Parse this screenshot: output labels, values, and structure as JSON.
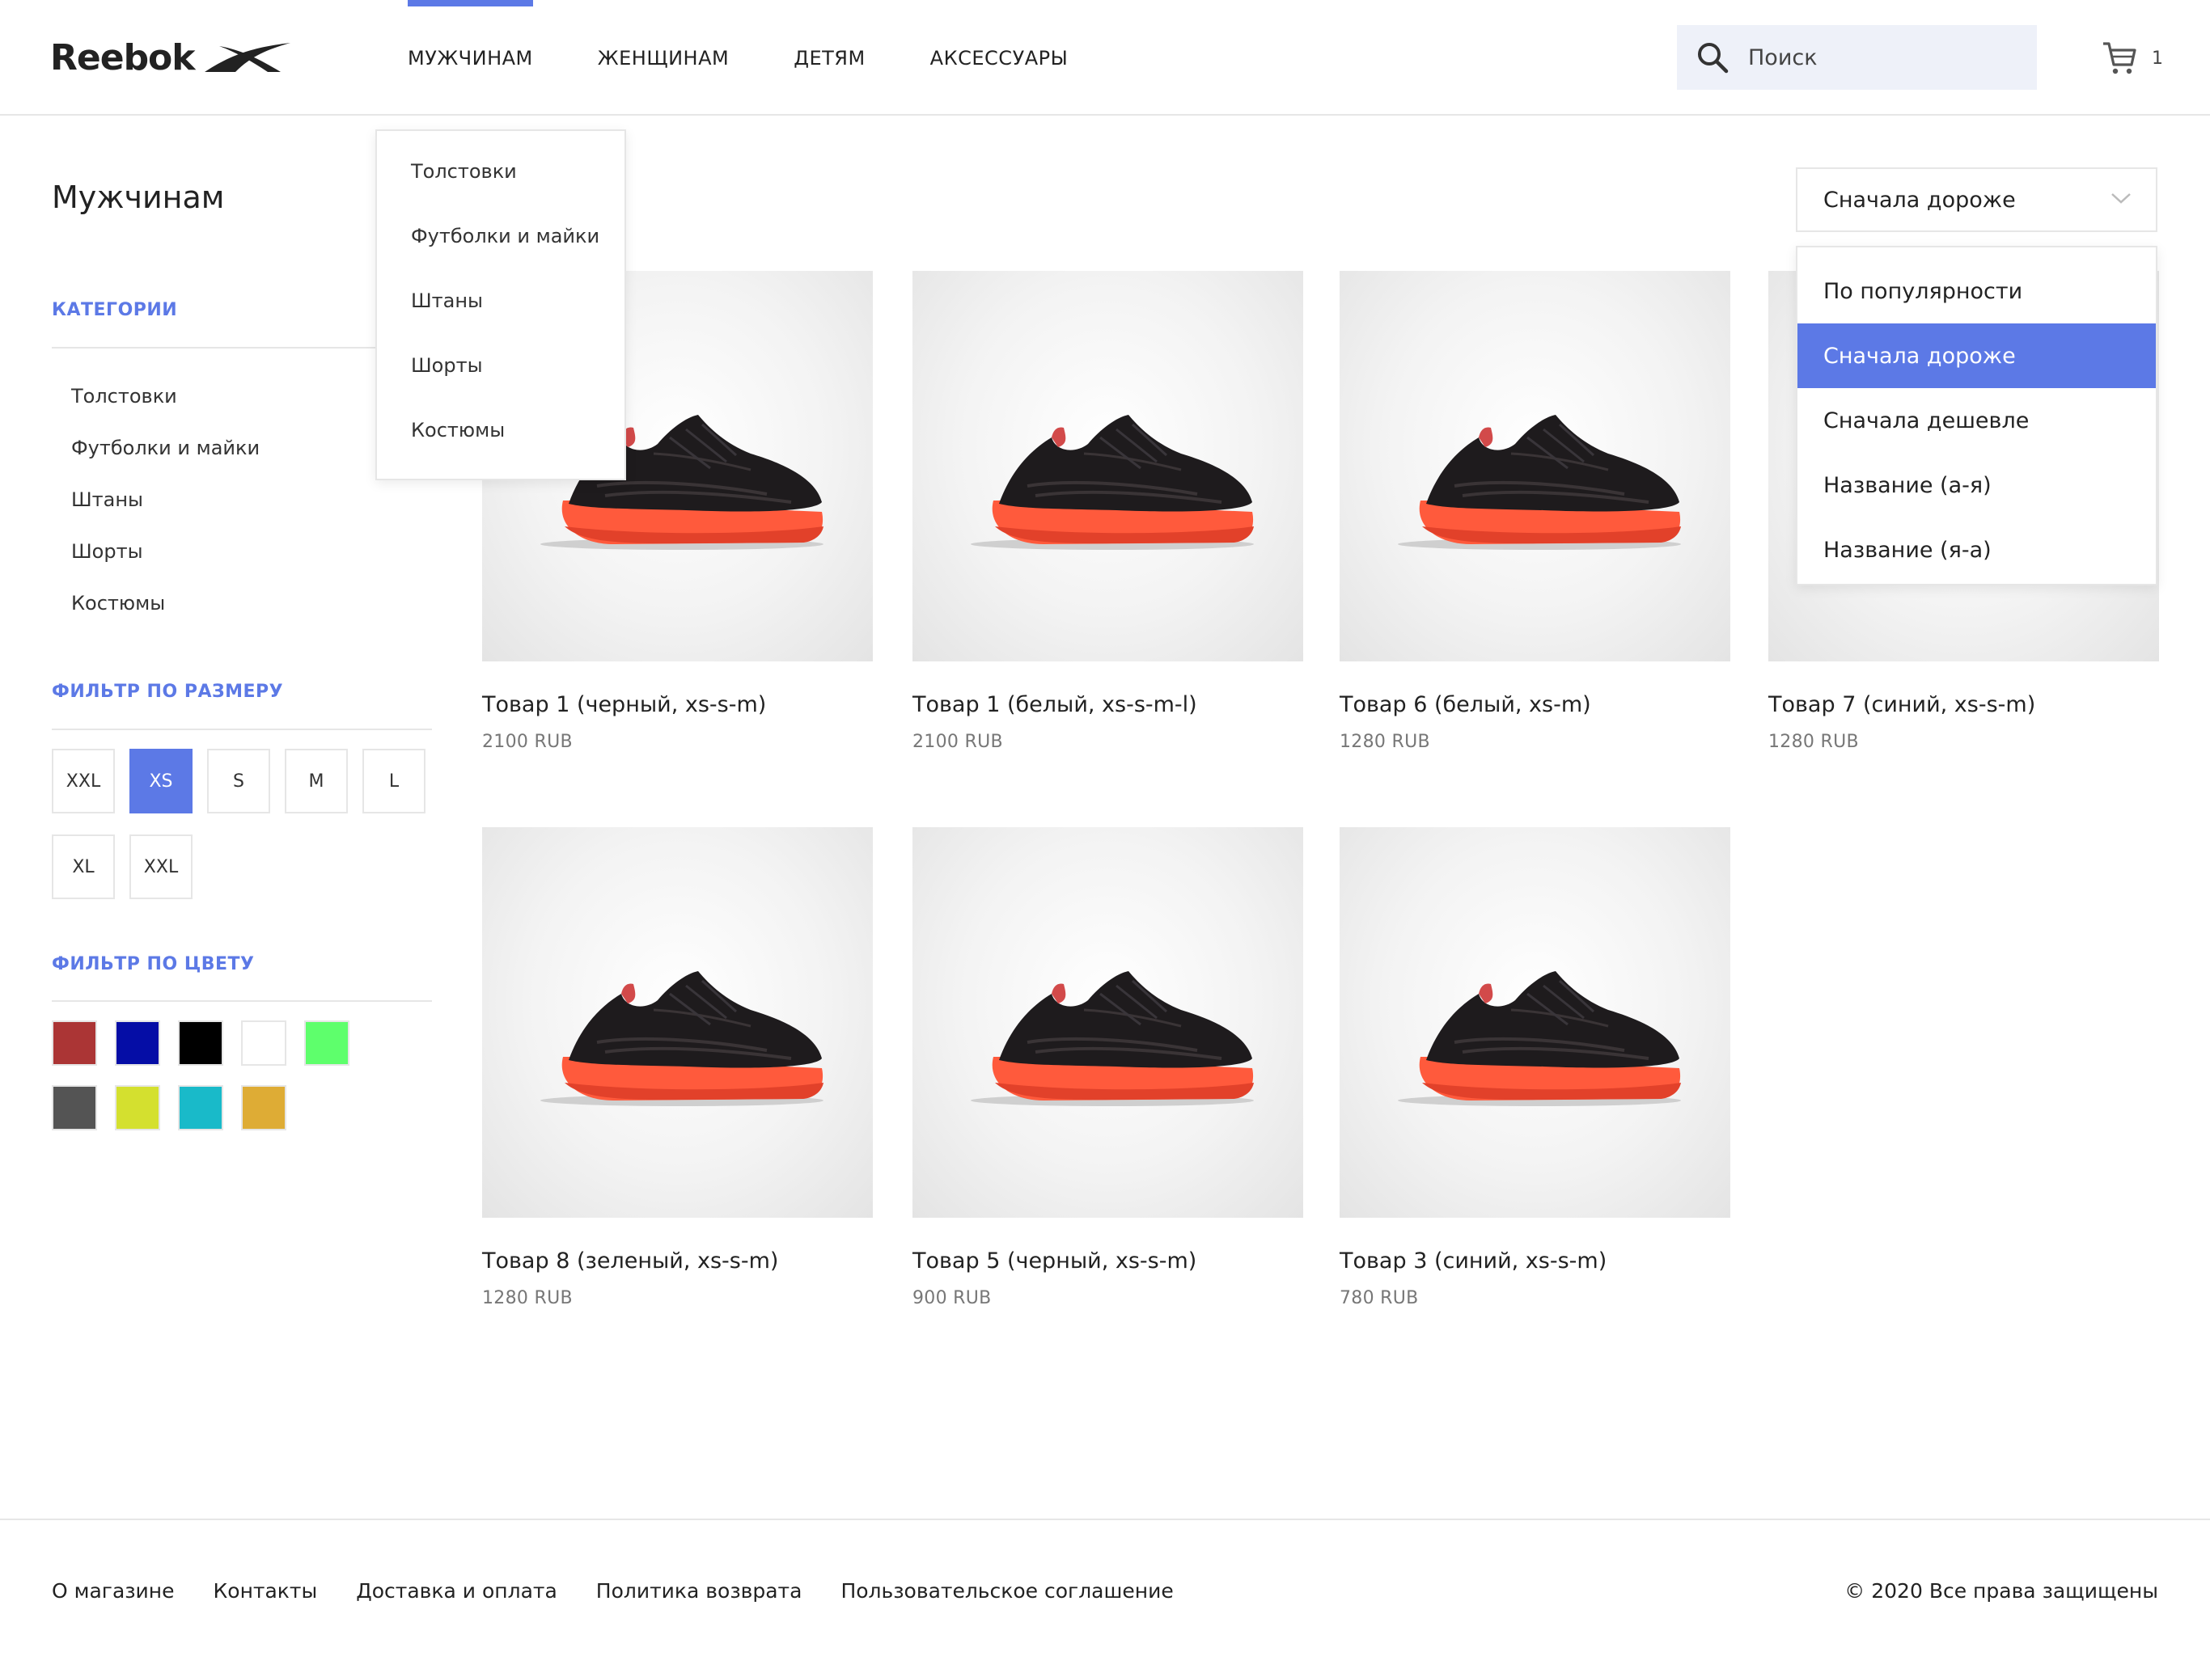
{
  "brand": {
    "name": "Reebok"
  },
  "nav": [
    {
      "label": "МУЖЧИНАМ",
      "active": true
    },
    {
      "label": "ЖЕНЩИНАМ"
    },
    {
      "label": "ДЕТЯМ"
    },
    {
      "label": "АКСЕССУАРЫ"
    }
  ],
  "search": {
    "placeholder": "Поиск",
    "icon": "search-icon"
  },
  "cart": {
    "count": "1",
    "icon": "cart-icon"
  },
  "nav_dropdown": [
    "Толстовки",
    "Футболки и майки",
    "Штаны",
    "Шорты",
    "Костюмы"
  ],
  "page_title": "Мужчинам",
  "sidebar": {
    "categories_title": "КАТЕГОРИИ",
    "categories": [
      "Толстовки",
      "Футболки и майки",
      "Штаны",
      "Шорты",
      "Костюмы"
    ],
    "size_title": "ФИЛЬТР ПО РАЗМЕРУ",
    "sizes": [
      {
        "label": "XXL"
      },
      {
        "label": "XS",
        "selected": true
      },
      {
        "label": "S"
      },
      {
        "label": "M"
      },
      {
        "label": "L"
      },
      {
        "label": "XL"
      },
      {
        "label": "XXL"
      }
    ],
    "color_title": "ФИЛЬТР ПО ЦВЕТУ",
    "colors": [
      "#ab3535",
      "#050da6",
      "#000000",
      "#ffffff",
      "#5eff6c",
      "#545454",
      "#d4e02f",
      "#19bac9",
      "#deac35"
    ]
  },
  "sort": {
    "selected": "Сначала дороже",
    "options": [
      {
        "label": "По популярности"
      },
      {
        "label": "Сначала дороже",
        "active": true
      },
      {
        "label": "Сначала дешевле"
      },
      {
        "label": "Название (а-я)"
      },
      {
        "label": "Название (я-а)"
      }
    ]
  },
  "products": [
    {
      "name": "Товар 1 (черный, xs-s-m)",
      "price": "2100 RUB"
    },
    {
      "name": "Товар 1 (белый, xs-s-m-l)",
      "price": "2100 RUB"
    },
    {
      "name": "Товар 6 (белый, xs-m)",
      "price": "1280 RUB"
    },
    {
      "name": "Товар 7 (синий, xs-s-m)",
      "price": "1280 RUB"
    },
    {
      "name": "Товар 8 (зеленый, xs-s-m)",
      "price": "1280 RUB"
    },
    {
      "name": "Товар 5 (черный, xs-s-m)",
      "price": "900 RUB"
    },
    {
      "name": "Товар 3 (синий, xs-s-m)",
      "price": "780 RUB"
    }
  ],
  "footer": {
    "links": [
      "О магазине",
      "Контакты",
      "Доставка и оплата",
      "Политика возврата",
      "Пользовательское соглашение"
    ],
    "copyright": "© 2020 Все права защищены"
  },
  "accent_color": "#5c79e6"
}
